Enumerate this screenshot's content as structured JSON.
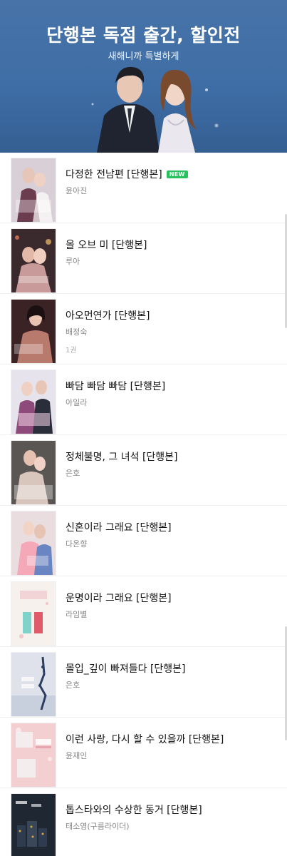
{
  "banner": {
    "title": "단행본 독점 출간, 할인전",
    "subtitle": "새해니까 특별하게"
  },
  "books": [
    {
      "title": "다정한 전남편 [단행본]",
      "author": "윤아진",
      "badge": "NEW",
      "extra": ""
    },
    {
      "title": "올 오브 미 [단행본]",
      "author": "루아",
      "badge": "",
      "extra": ""
    },
    {
      "title": "아오먼연가 [단행본]",
      "author": "배정숙",
      "badge": "",
      "extra": "1권"
    },
    {
      "title": "빠담 빠담 빠담 [단행본]",
      "author": "아일라",
      "badge": "",
      "extra": ""
    },
    {
      "title": "정체불명, 그 녀석 [단행본]",
      "author": "은호",
      "badge": "",
      "extra": ""
    },
    {
      "title": "신혼이라 그래요 [단행본]",
      "author": "다온향",
      "badge": "",
      "extra": ""
    },
    {
      "title": "운명이라 그래요 [단행본]",
      "author": "라임별",
      "badge": "",
      "extra": ""
    },
    {
      "title": "몰입_깊이 빠져들다 [단행본]",
      "author": "은호",
      "badge": "",
      "extra": ""
    },
    {
      "title": "이런 사랑, 다시 할 수 있을까 [단행본]",
      "author": "윤재인",
      "badge": "",
      "extra": ""
    },
    {
      "title": "톱스타와의 수상한 동거 [단행본]",
      "author": "태소영(구름라이더)",
      "badge": "",
      "extra": ""
    }
  ],
  "covers": [
    {
      "bg": "#d9cfd6",
      "accent": "#6b3b4e"
    },
    {
      "bg": "#3a2a2e",
      "accent": "#c99a9a"
    },
    {
      "bg": "#3b2224",
      "accent": "#b97a6e"
    },
    {
      "bg": "#e7e3ec",
      "accent": "#8d4a7a"
    },
    {
      "bg": "#5a5654",
      "accent": "#d8c6bd"
    },
    {
      "bg": "#e9dde0",
      "accent": "#6a86c2"
    },
    {
      "bg": "#f6f1ec",
      "accent": "#e05a6a"
    },
    {
      "bg": "#dfe2ea",
      "accent": "#2c3f63"
    },
    {
      "bg": "#f3cfd2",
      "accent": "#f2f2f2"
    },
    {
      "bg": "#1f2733",
      "accent": "#d9a441"
    }
  ]
}
